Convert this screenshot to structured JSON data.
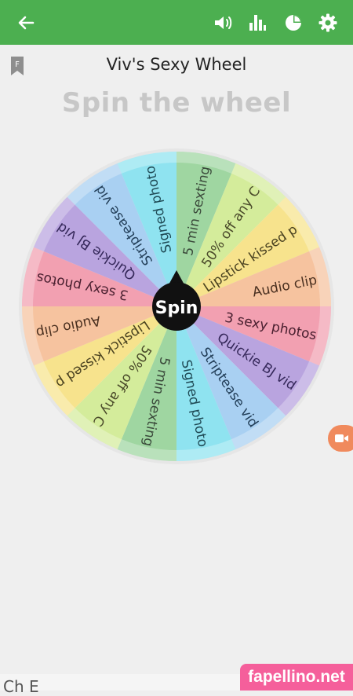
{
  "app": {
    "wheel_title": "Viv's Sexy Wheel",
    "headline": "Spin the wheel",
    "spin_label": "Spin",
    "bottom_partial_text": "Ch  E",
    "watermark": "fapellino.net"
  },
  "toolbar": {
    "back_icon": "arrow-left-icon",
    "icons": [
      "volume-icon",
      "bar-chart-icon",
      "pie-chart-icon",
      "gear-icon"
    ]
  },
  "colors": {
    "topbar": "#4caf50",
    "background": "#efefef",
    "headline": "#c7c7c7",
    "watermark": "#f55f9b",
    "side_pill": "#f08a5d"
  },
  "wheel": {
    "segments": [
      {
        "label": "5 min sexting",
        "color": "#9fd6a1",
        "text": "#3b4a3b"
      },
      {
        "label": "50% off any C",
        "color": "#d4ec9b",
        "text": "#4a4a2a"
      },
      {
        "label": "Lipstick kissed p",
        "color": "#f7e38d",
        "text": "#4a4220"
      },
      {
        "label": "Audio clip",
        "color": "#f6c39f",
        "text": "#4a3020"
      },
      {
        "label": "3 sexy photos",
        "color": "#f2a0b1",
        "text": "#4a2030"
      },
      {
        "label": "Quickie BJ vid",
        "color": "#b9a4df",
        "text": "#35285a"
      },
      {
        "label": "Striptease vid",
        "color": "#a9d0f2",
        "text": "#24405a"
      },
      {
        "label": "Signed photo",
        "color": "#8fe3f0",
        "text": "#1f4a55"
      },
      {
        "label": "5 min sexting",
        "color": "#9fd6a1",
        "text": "#3b4a3b"
      },
      {
        "label": "50% off any C",
        "color": "#d4ec9b",
        "text": "#4a4a2a"
      },
      {
        "label": "Lipstick kissed p",
        "color": "#f7e38d",
        "text": "#4a4220"
      },
      {
        "label": "Audio clip",
        "color": "#f6c39f",
        "text": "#4a3020"
      },
      {
        "label": "3 sexy photos",
        "color": "#f2a0b1",
        "text": "#4a2030"
      },
      {
        "label": "Quickie BJ vid",
        "color": "#b9a4df",
        "text": "#35285a"
      },
      {
        "label": "Striptease vid",
        "color": "#a9d0f2",
        "text": "#24405a"
      },
      {
        "label": "Signed photo",
        "color": "#8fe3f0",
        "text": "#1f4a55"
      }
    ]
  }
}
